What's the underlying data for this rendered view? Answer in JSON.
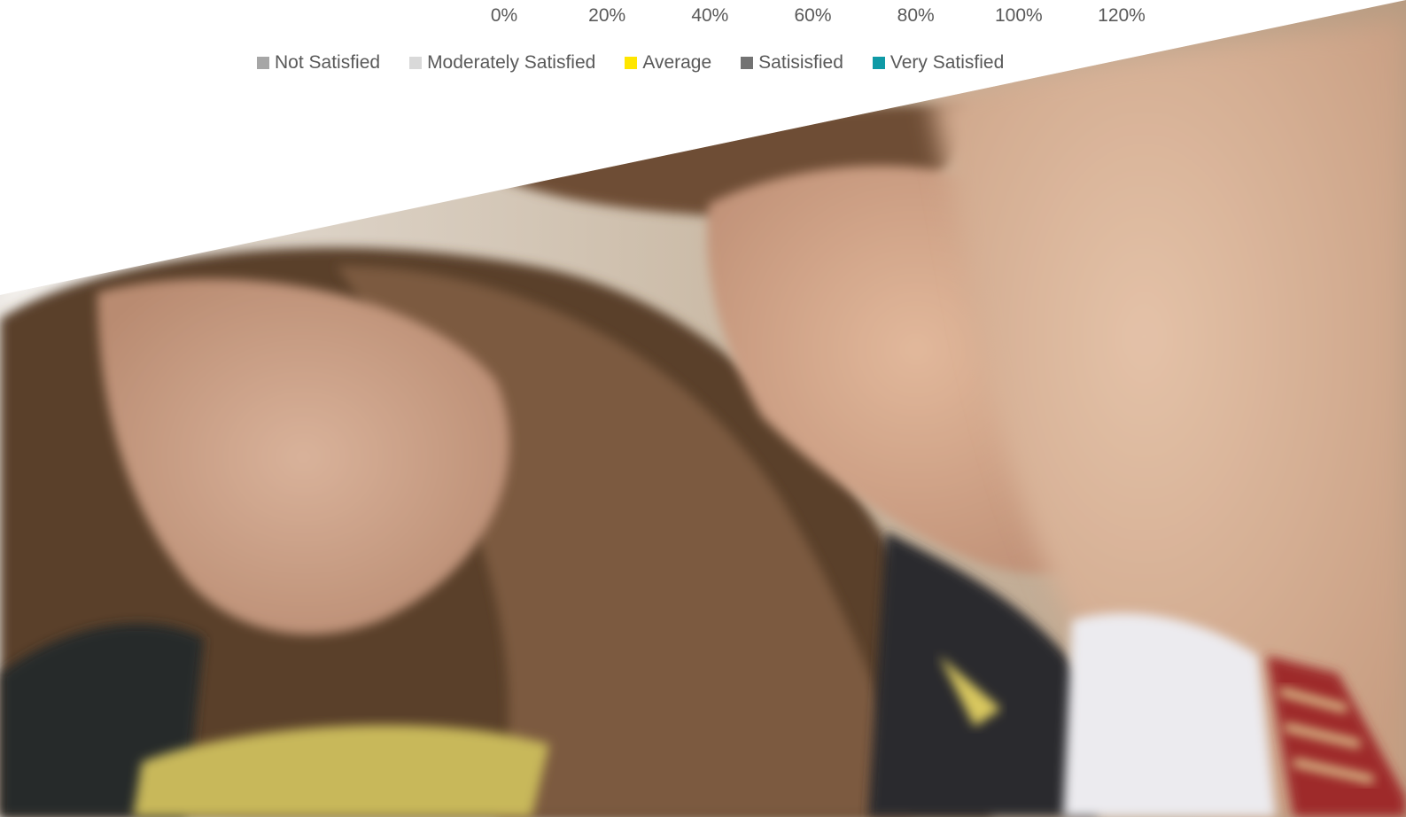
{
  "chart_data": {
    "type": "bar",
    "orientation": "horizontal",
    "stacked": true,
    "title": "",
    "xlabel": "",
    "ylabel": "",
    "xlim": [
      0,
      120
    ],
    "x_ticks": [
      "0%",
      "20%",
      "40%",
      "60%",
      "80%",
      "100%",
      "120%"
    ],
    "categories": [],
    "series": [
      {
        "name": "Not Satisfied",
        "color": "#a6a6a6",
        "values": []
      },
      {
        "name": "Moderately Satisfied",
        "color": "#d9d9d9",
        "values": []
      },
      {
        "name": "Average",
        "color": "#ffe600",
        "values": []
      },
      {
        "name": "Satisisfied",
        "color": "#737373",
        "values": []
      },
      {
        "name": "Very Satisfied",
        "color": "#0f9aa6",
        "values": []
      }
    ],
    "legend_position": "bottom",
    "grid": false
  },
  "photo": {
    "icon": "photo-three-people-reading"
  }
}
